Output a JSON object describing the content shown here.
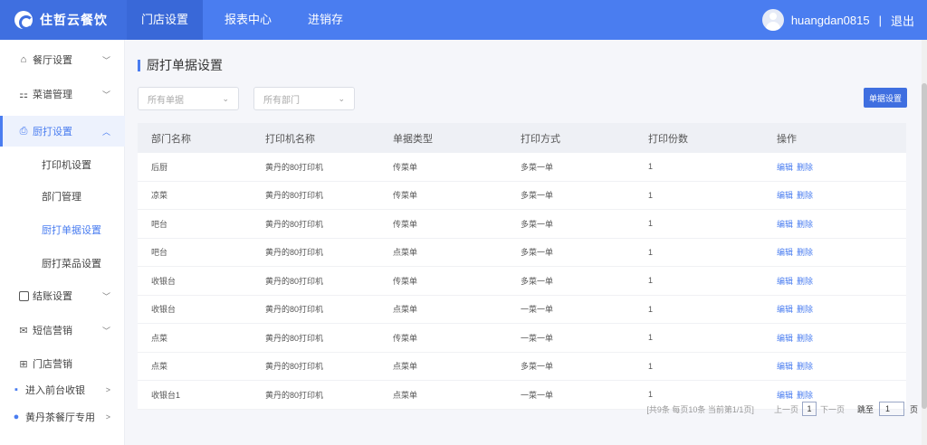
{
  "brand": {
    "name": "住哲云餐饮"
  },
  "nav": [
    {
      "label": "门店设置"
    },
    {
      "label": "报表中心"
    },
    {
      "label": "进销存"
    }
  ],
  "user": {
    "name": "huangdan0815",
    "separator": "|",
    "logout": "退出"
  },
  "sidebar": {
    "items": [
      {
        "label": "餐厅设置",
        "icon": "home-icon",
        "arrow": "﹀"
      },
      {
        "label": "菜谱管理",
        "icon": "grid-icon",
        "arrow": "﹀"
      },
      {
        "label": "厨打设置",
        "icon": "printer-icon",
        "arrow": "︿"
      },
      {
        "label": "打印机设置"
      },
      {
        "label": "部门管理"
      },
      {
        "label": "厨打单据设置"
      },
      {
        "label": "厨打菜品设置"
      },
      {
        "label": "结账设置",
        "icon": "checkout-icon",
        "arrow": "﹀"
      },
      {
        "label": "短信营销",
        "icon": "mail-icon",
        "arrow": "﹀"
      },
      {
        "label": "门店营销",
        "icon": "gift-icon"
      },
      {
        "label": "进入前台收银",
        "icon": "cashier-icon",
        "arrow": ">"
      },
      {
        "label": "黄丹茶餐厅专用",
        "icon": "location-icon",
        "arrow": ">"
      }
    ]
  },
  "page": {
    "title": "厨打单据设置",
    "filter_doc": "所有单据",
    "filter_dept": "所有部门",
    "action_button": "单据设置"
  },
  "table": {
    "headers": [
      "部门名称",
      "打印机名称",
      "单据类型",
      "打印方式",
      "打印份数",
      "操作"
    ],
    "rows": [
      {
        "dept": "后厨",
        "printer": "黄丹的80打印机",
        "type": "传菜单",
        "mode": "多菜一单",
        "copies": "1"
      },
      {
        "dept": "凉菜",
        "printer": "黄丹的80打印机",
        "type": "传菜单",
        "mode": "多菜一单",
        "copies": "1"
      },
      {
        "dept": "吧台",
        "printer": "黄丹的80打印机",
        "type": "传菜单",
        "mode": "多菜一单",
        "copies": "1"
      },
      {
        "dept": "吧台",
        "printer": "黄丹的80打印机",
        "type": "点菜单",
        "mode": "多菜一单",
        "copies": "1"
      },
      {
        "dept": "收银台",
        "printer": "黄丹的80打印机",
        "type": "传菜单",
        "mode": "多菜一单",
        "copies": "1"
      },
      {
        "dept": "收银台",
        "printer": "黄丹的80打印机",
        "type": "点菜单",
        "mode": "一菜一单",
        "copies": "1"
      },
      {
        "dept": "点菜",
        "printer": "黄丹的80打印机",
        "type": "传菜单",
        "mode": "一菜一单",
        "copies": "1"
      },
      {
        "dept": "点菜",
        "printer": "黄丹的80打印机",
        "type": "点菜单",
        "mode": "多菜一单",
        "copies": "1"
      },
      {
        "dept": "收银台1",
        "printer": "黄丹的80打印机",
        "type": "点菜单",
        "mode": "一菜一单",
        "copies": "1"
      }
    ],
    "edit_label": "编辑",
    "delete_label": "删除"
  },
  "pager": {
    "summary": "[共9条 每页10条 当前第1/1页]",
    "prev": "上一页",
    "current": "1",
    "next": "下一页",
    "jump_label": "跳至",
    "jump_value": "1",
    "page_unit": "页"
  },
  "colors": {
    "primary": "#4a7df0",
    "brand_dark": "#3f6fe0"
  }
}
